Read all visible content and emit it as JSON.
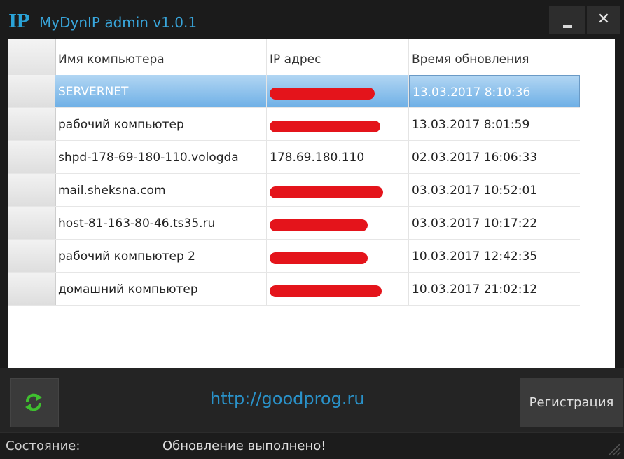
{
  "window": {
    "icon_text": "IP",
    "title": "MyDynIP admin v1.0.1",
    "close_glyph": "✕"
  },
  "table": {
    "columns": [
      "Имя компьютера",
      "IP адрес",
      "Время обновления"
    ],
    "rows": [
      {
        "name": "SERVERNET",
        "ip": "",
        "time": "13.03.2017 8:10:36",
        "selected": true
      },
      {
        "name": "рабочий компьютер",
        "ip": "",
        "time": "13.03.2017 8:01:59"
      },
      {
        "name": "shpd-178-69-180-110.vologda",
        "ip": "178.69.180.110",
        "time": "02.03.2017 16:06:33"
      },
      {
        "name": "mail.sheksna.com",
        "ip": "",
        "time": "03.03.2017 10:52:01"
      },
      {
        "name": "host-81-163-80-46.ts35.ru",
        "ip": "",
        "time": "03.03.2017 10:17:22"
      },
      {
        "name": "рабочий компьютер 2",
        "ip": "",
        "time": "10.03.2017 12:42:35"
      },
      {
        "name": "домашний компьютер",
        "ip": "",
        "time": "10.03.2017 21:02:12"
      }
    ]
  },
  "toolbar": {
    "refresh_icon": "refresh-icon",
    "link": "http://goodprog.ru",
    "register_label": "Регистрация"
  },
  "status": {
    "label": "Состояние:",
    "text": "Обновление выполнено!"
  },
  "colors": {
    "accent": "#2aa3d8",
    "selection": "#6fb0e6",
    "redaction": "#e4141b"
  }
}
